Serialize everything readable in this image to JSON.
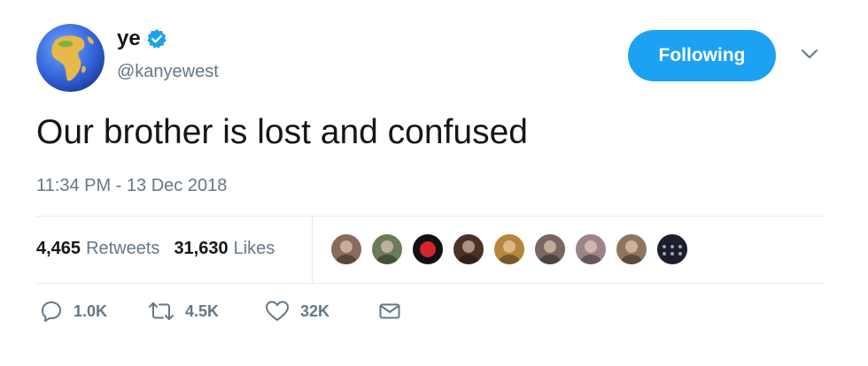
{
  "user": {
    "name": "ye",
    "handle": "@kanyewest",
    "verified": true,
    "avatar_icon": "globe-africa-icon"
  },
  "follow_button": {
    "label": "Following",
    "color": "#1da1f2"
  },
  "tweet": {
    "text": "Our brother is lost and confused",
    "timestamp": "11:34 PM - 13 Dec 2018"
  },
  "stats": {
    "retweets_count": "4,465",
    "retweets_label": "Retweets",
    "likes_count": "31,630",
    "likes_label": "Likes"
  },
  "liked_by_avatars": [
    {
      "icon": "user-avatar-1",
      "color": "#8a6a5c"
    },
    {
      "icon": "user-avatar-2",
      "color": "#6b7b5a"
    },
    {
      "icon": "tsr-logo-avatar",
      "color": "#111111"
    },
    {
      "icon": "user-avatar-4",
      "color": "#4a3326"
    },
    {
      "icon": "user-avatar-5",
      "color": "#b5863b"
    },
    {
      "icon": "user-avatar-6",
      "color": "#7a6660"
    },
    {
      "icon": "user-avatar-7",
      "color": "#9d8488"
    },
    {
      "icon": "user-avatar-8",
      "color": "#8f7560"
    },
    {
      "icon": "dark-photo-avatar",
      "color": "#1a1f2b"
    }
  ],
  "actions": {
    "reply_count": "1.0K",
    "retweet_count": "4.5K",
    "like_count": "32K"
  },
  "colors": {
    "text": "#14171a",
    "secondary": "#657786",
    "divider": "#e6ecf0",
    "accent": "#1da1f2"
  }
}
